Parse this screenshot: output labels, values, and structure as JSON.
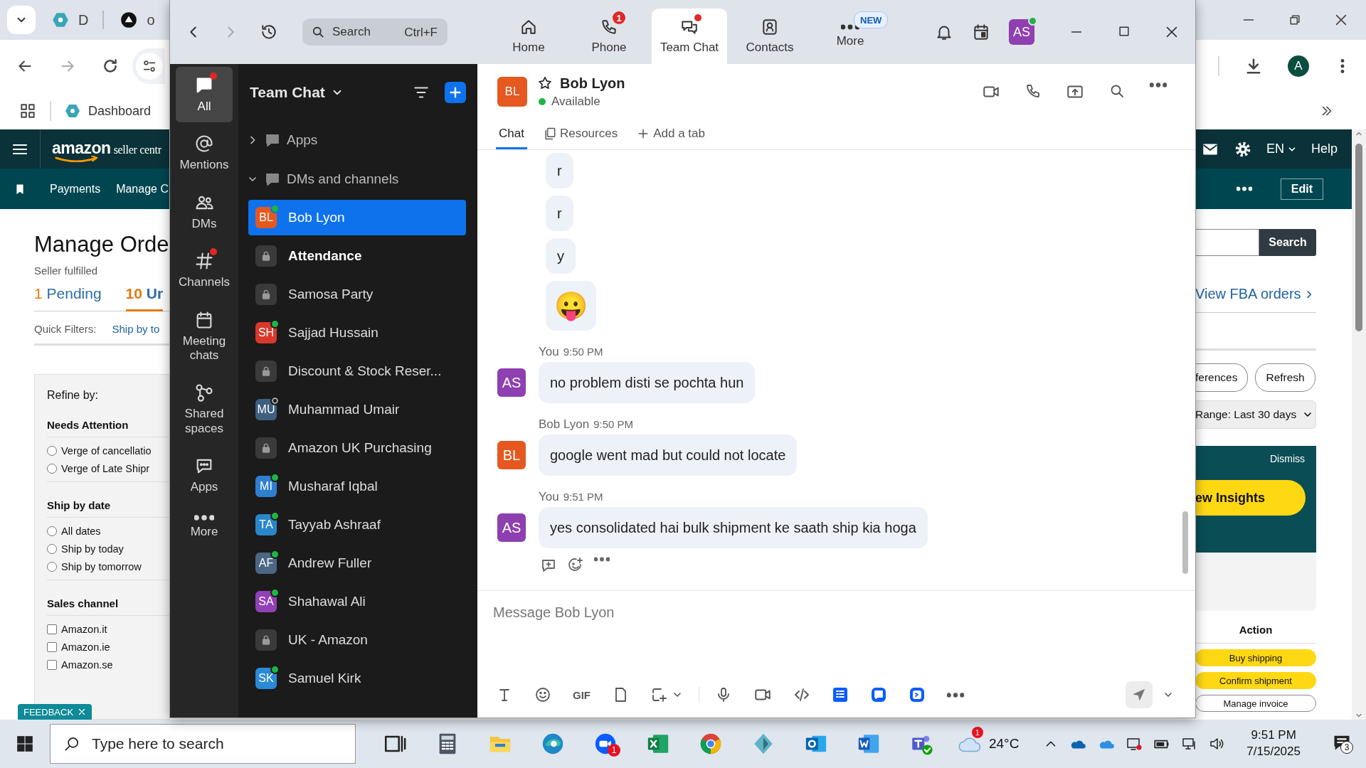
{
  "browser": {
    "tabs": [
      {
        "label": "D"
      },
      {
        "label": "o"
      }
    ],
    "bookmark": "Dashboard",
    "profile": "A"
  },
  "seller": {
    "logo": "amazon",
    "logo_suffix": "seller centr",
    "language": "EN",
    "help": "Help",
    "nav": [
      "Payments",
      "Manage C"
    ],
    "edit": "Edit",
    "title": "Manage Orde",
    "subtitle": "Seller fulfilled",
    "order_tabs": [
      {
        "count": "1",
        "label": "Pending",
        "selected": false
      },
      {
        "count": "10",
        "label": "Ur",
        "selected": true
      }
    ],
    "quick_filters": {
      "label": "Quick Filters:",
      "link": "Ship by to"
    },
    "refine": {
      "title": "Refine by:",
      "groups": [
        {
          "heading": "Needs Attention",
          "kind": "radio",
          "options": [
            {
              "label": "Verge of cancellatio",
              "checked": false
            },
            {
              "label": "Verge of Late Shipr",
              "checked": false
            }
          ]
        },
        {
          "heading": "Ship by date",
          "kind": "radio",
          "options": [
            {
              "label": "All dates",
              "checked": false
            },
            {
              "label": "Ship by today",
              "checked": false
            },
            {
              "label": "Ship by tomorrow",
              "checked": false
            }
          ]
        },
        {
          "heading": "Sales channel",
          "kind": "checkbox",
          "options": [
            {
              "label": "Amazon.it",
              "checked": false
            },
            {
              "label": "Amazon.ie",
              "checked": false
            },
            {
              "label": "Amazon.se",
              "checked": false
            }
          ]
        }
      ]
    },
    "feedback": "FEEDBACK",
    "search_button": "Search",
    "fba_link": "View FBA orders",
    "buttons": [
      "ferences",
      "Refresh"
    ],
    "range": "Range: Last 30 days",
    "insights": {
      "dismiss": "Dismiss",
      "button": "ew Insights"
    },
    "action_heading": "Action",
    "actions": [
      {
        "label": "Buy shipping",
        "kind": "primary"
      },
      {
        "label": "Confirm shipment",
        "kind": "primary"
      },
      {
        "label": "Manage invoice",
        "kind": "secondary"
      }
    ]
  },
  "zoom": {
    "search": {
      "placeholder": "Search",
      "shortcut": "Ctrl+F"
    },
    "tabs": [
      {
        "label": "Home",
        "selected": false
      },
      {
        "label": "Phone",
        "selected": false,
        "badge": "1"
      },
      {
        "label": "Team Chat",
        "selected": true,
        "dot": true
      },
      {
        "label": "Contacts",
        "selected": false
      },
      {
        "label": "More",
        "selected": false,
        "tag": "NEW"
      }
    ],
    "user": {
      "initials": "AS",
      "color": "#8e3fb0",
      "online": true
    },
    "rail": [
      {
        "label": "All",
        "selected": true,
        "unread": true
      },
      {
        "label": "Mentions",
        "selected": false,
        "unread": false
      },
      {
        "label": "DMs",
        "selected": false,
        "unread": false
      },
      {
        "label": "Channels",
        "selected": false,
        "unread": true
      },
      {
        "label": "Meeting chats",
        "selected": false,
        "unread": false
      },
      {
        "label": "Shared spaces",
        "selected": false,
        "unread": false
      },
      {
        "label": "Apps",
        "selected": false,
        "unread": false
      },
      {
        "label": "More",
        "selected": false,
        "unread": false
      }
    ],
    "sidebar": {
      "title": "Team Chat",
      "sections": [
        {
          "label": "Apps",
          "expanded": false
        },
        {
          "label": "DMs and channels",
          "expanded": true
        }
      ],
      "items": [
        {
          "kind": "dm",
          "name": "Bob Lyon",
          "initials": "BL",
          "color": "#e5581f",
          "online": true,
          "selected": true,
          "unread": false
        },
        {
          "kind": "channel",
          "name": "Attendance",
          "selected": false,
          "unread": true
        },
        {
          "kind": "channel",
          "name": "Samosa Party",
          "selected": false,
          "unread": false
        },
        {
          "kind": "dm",
          "name": "Sajjad Hussain",
          "initials": "SH",
          "color": "#d8392b",
          "online": true,
          "selected": false,
          "unread": false
        },
        {
          "kind": "channel",
          "name": "Discount & Stock Reser...",
          "selected": false,
          "unread": false
        },
        {
          "kind": "dm",
          "name": "Muhammad Umair",
          "initials": "MU",
          "color": "#3f5f80",
          "online": false,
          "selected": false,
          "unread": false
        },
        {
          "kind": "channel",
          "name": "Amazon UK Purchasing",
          "selected": false,
          "unread": false
        },
        {
          "kind": "dm",
          "name": "Musharaf Iqbal",
          "initials": "MI",
          "color": "#2f7fd0",
          "online": true,
          "selected": false,
          "unread": false
        },
        {
          "kind": "dm",
          "name": "Tayyab Ashraaf",
          "initials": "TA",
          "color": "#2a86c9",
          "online": true,
          "selected": false,
          "unread": false
        },
        {
          "kind": "dm",
          "name": "Andrew Fuller",
          "initials": "AF",
          "color": "#4a6784",
          "online": true,
          "selected": false,
          "unread": false
        },
        {
          "kind": "dm",
          "name": "Shahawal Ali",
          "initials": "SA",
          "color": "#9140b5",
          "online": true,
          "selected": false,
          "unread": false
        },
        {
          "kind": "channel",
          "name": "UK - Amazon",
          "selected": false,
          "unread": false
        },
        {
          "kind": "dm",
          "name": "Samuel Kirk",
          "initials": "SK",
          "color": "#2b8ad6",
          "online": true,
          "selected": false,
          "unread": false
        }
      ]
    },
    "chat": {
      "contact": {
        "name": "Bob Lyon",
        "initials": "BL",
        "color": "#e5581f",
        "starred": false,
        "presence": "Available",
        "online": true
      },
      "tabs": [
        {
          "label": "Chat",
          "selected": true
        },
        {
          "label": "Resources",
          "selected": false
        }
      ],
      "add_tab": "Add a tab",
      "messages": [
        {
          "kind": "follow",
          "text": "r"
        },
        {
          "kind": "follow",
          "text": "r"
        },
        {
          "kind": "follow",
          "text": "y"
        },
        {
          "kind": "emoji",
          "text": "😛"
        },
        {
          "kind": "message",
          "sender": "You",
          "time": "9:50 PM",
          "initials": "AS",
          "color": "#8e3fb0",
          "text": "no problem disti se pochta hun"
        },
        {
          "kind": "message",
          "sender": "Bob Lyon",
          "time": "9:50 PM",
          "initials": "BL",
          "color": "#e5581f",
          "text": "google went mad but could not locate"
        },
        {
          "kind": "message",
          "sender": "You",
          "time": "9:51 PM",
          "initials": "AS",
          "color": "#8e3fb0",
          "text": "yes consolidated hai bulk shipment ke saath ship kia hoga"
        }
      ],
      "composer": {
        "placeholder": "Message Bob Lyon",
        "gif": "GIF"
      }
    }
  },
  "taskbar": {
    "search_placeholder": "Type here to search",
    "video_badge": "1",
    "weather_badge": "1",
    "temperature": "24°C",
    "time": "9:51 PM",
    "date": "7/15/2025",
    "notifications": "3"
  }
}
